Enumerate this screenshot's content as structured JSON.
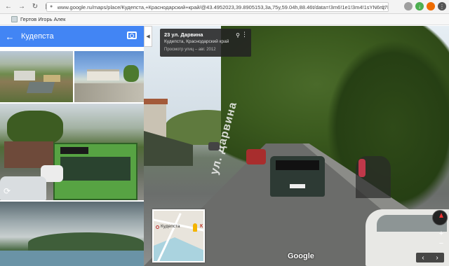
{
  "browser": {
    "url": "www.google.ru/maps/place/Кудепста,+Краснодарский+край/@43.4952023,39.8905153,3a,75y,59.04h,88.46t/data=!3m6!1e1!3m4!1sYN6rq7RvU68!",
    "bookmark_label": "Гертов Игорь Алек"
  },
  "panel": {
    "title": "Кудепста",
    "back_icon": "arrow-left-icon",
    "camera_icon": "camera-icon",
    "rotate_icon": "360-rotate-icon"
  },
  "streetview": {
    "street_name": "23 ул. Дарвина",
    "region": "Кудепста, Краснодарский край",
    "capture_date": "Просмотр улиц – авг. 2012",
    "road_marking": "ул. Дарвина",
    "minimap_label": "Кудепста",
    "minimap_marker_letter": "К",
    "watermark": "Google"
  },
  "colors": {
    "header_blue": "#4285f4",
    "card_bg": "#232323"
  }
}
